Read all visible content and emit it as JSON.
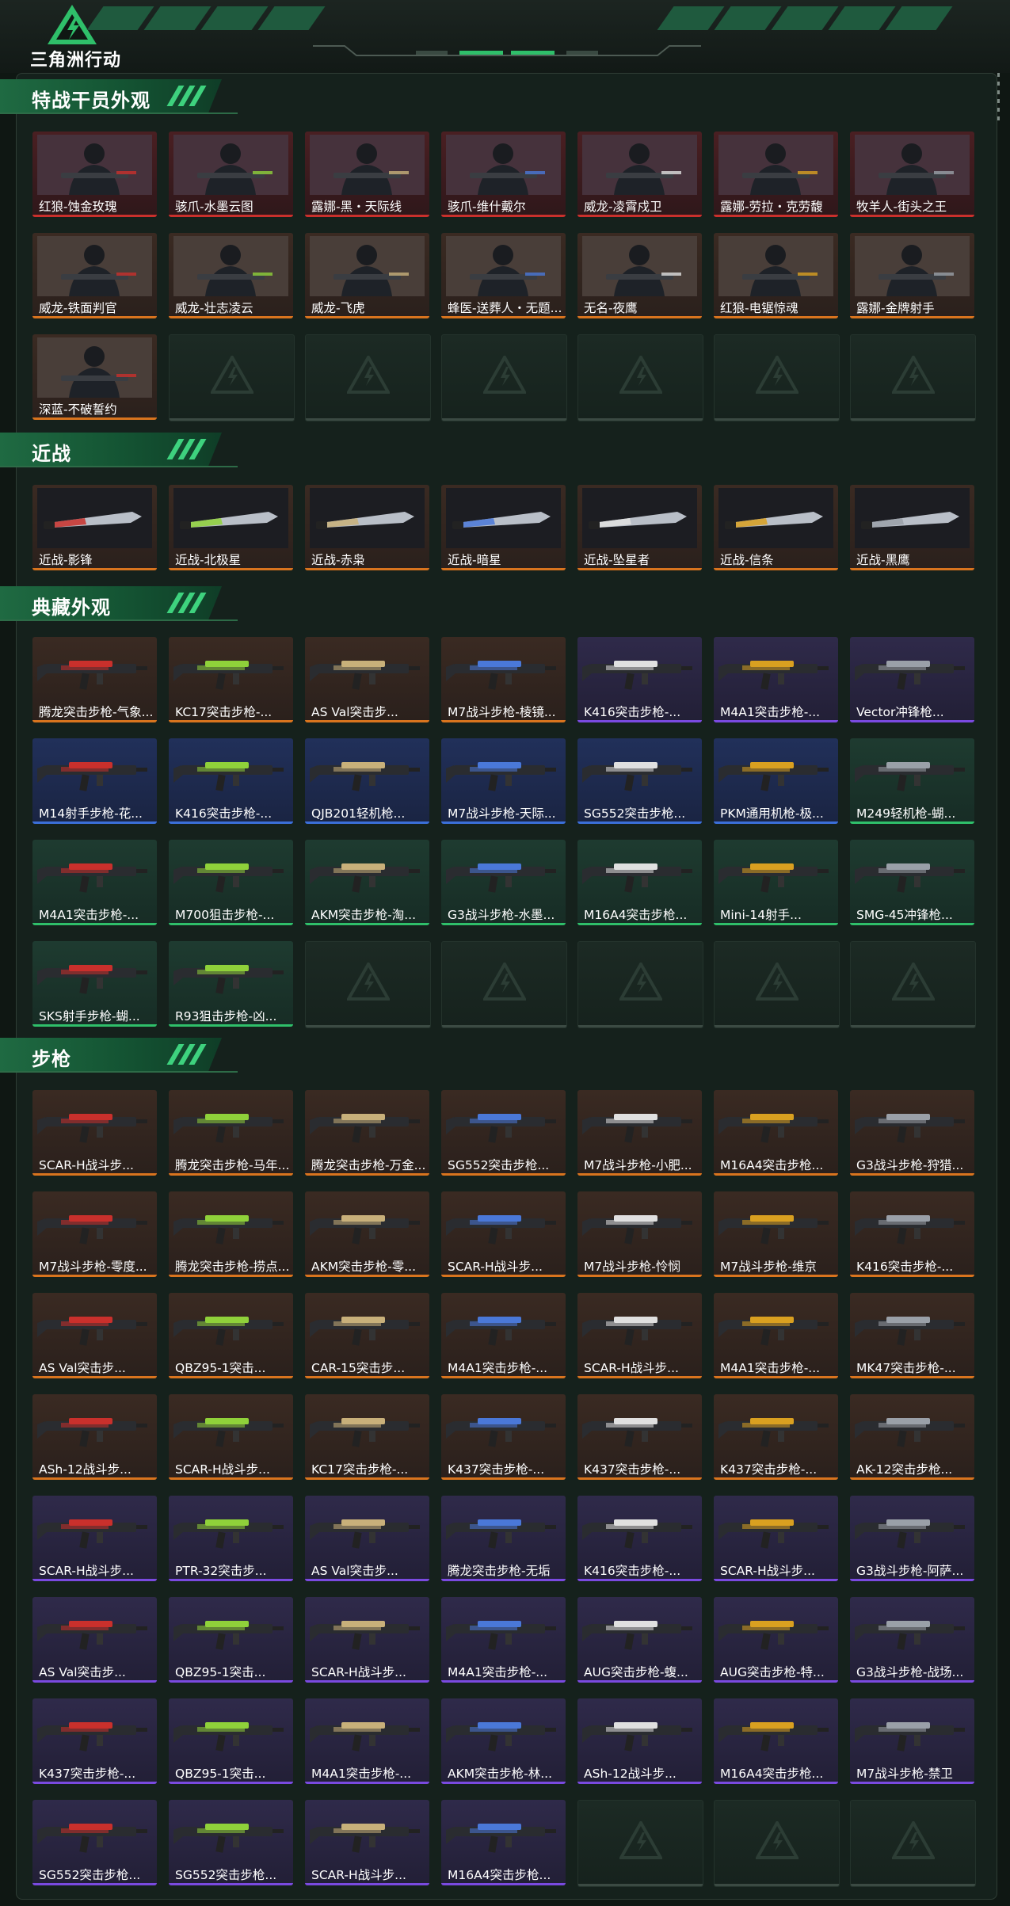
{
  "app": {
    "logo_text": "三角洲行动"
  },
  "sections": [
    {
      "title": "特战干员外观",
      "items": [
        {
          "label": "红狼-蚀金玫瑰",
          "tier": "red",
          "art": "operator"
        },
        {
          "label": "骇爪-水墨云图",
          "tier": "red",
          "art": "operator"
        },
        {
          "label": "露娜-黑・天际线",
          "tier": "red",
          "art": "operator"
        },
        {
          "label": "骇爪-维什戴尔",
          "tier": "red",
          "art": "operator"
        },
        {
          "label": "威龙-凌霄戍卫",
          "tier": "red",
          "art": "operator"
        },
        {
          "label": "露娜-劳拉・克劳馥",
          "tier": "red",
          "art": "operator"
        },
        {
          "label": "牧羊人-街头之王",
          "tier": "red",
          "art": "operator"
        },
        {
          "label": "威龙-铁面判官",
          "tier": "orange",
          "art": "operator"
        },
        {
          "label": "威龙-壮志凌云",
          "tier": "orange",
          "art": "operator"
        },
        {
          "label": "威龙-飞虎",
          "tier": "orange",
          "art": "operator"
        },
        {
          "label": "蜂医-送葬人・无题...",
          "tier": "orange",
          "art": "operator"
        },
        {
          "label": "无名-夜鹰",
          "tier": "orange",
          "art": "operator"
        },
        {
          "label": "红狼-电锯惊魂",
          "tier": "orange",
          "art": "operator"
        },
        {
          "label": "露娜-金牌射手",
          "tier": "orange",
          "art": "operator"
        },
        {
          "label": "深蓝-不破誓约",
          "tier": "orange",
          "art": "operator"
        },
        {
          "empty": true
        },
        {
          "empty": true
        },
        {
          "empty": true
        },
        {
          "empty": true
        },
        {
          "empty": true
        },
        {
          "empty": true
        }
      ]
    },
    {
      "title": "近战",
      "items": [
        {
          "label": "近战-影锋",
          "tier": "orange",
          "art": "melee"
        },
        {
          "label": "近战-北极星",
          "tier": "orange",
          "art": "melee"
        },
        {
          "label": "近战-赤枭",
          "tier": "orange",
          "art": "melee"
        },
        {
          "label": "近战-暗星",
          "tier": "orange",
          "art": "melee"
        },
        {
          "label": "近战-坠星者",
          "tier": "orange",
          "art": "melee"
        },
        {
          "label": "近战-信条",
          "tier": "orange",
          "art": "melee"
        },
        {
          "label": "近战-黑鹰",
          "tier": "orange",
          "art": "melee"
        }
      ]
    },
    {
      "title": "典藏外观",
      "items": [
        {
          "label": "腾龙突击步枪-气象...",
          "tier": "orange",
          "art": "gun"
        },
        {
          "label": "KC17突击步枪-...",
          "tier": "orange",
          "art": "gun"
        },
        {
          "label": "AS Val突击步...",
          "tier": "orange",
          "art": "gun"
        },
        {
          "label": "M7战斗步枪-棱镜...",
          "tier": "orange",
          "art": "gun"
        },
        {
          "label": "K416突击步枪-...",
          "tier": "purple",
          "art": "gun"
        },
        {
          "label": "M4A1突击步枪-...",
          "tier": "purple",
          "art": "gun"
        },
        {
          "label": "Vector冲锋枪...",
          "tier": "purple",
          "art": "gun"
        },
        {
          "label": "M14射手步枪-花...",
          "tier": "blue",
          "art": "gun"
        },
        {
          "label": "K416突击步枪-...",
          "tier": "blue",
          "art": "gun"
        },
        {
          "label": "QJB201轻机枪...",
          "tier": "blue",
          "art": "gun"
        },
        {
          "label": "M7战斗步枪-天际...",
          "tier": "blue",
          "art": "gun"
        },
        {
          "label": "SG552突击步枪...",
          "tier": "blue",
          "art": "gun"
        },
        {
          "label": "PKM通用机枪-极...",
          "tier": "blue",
          "art": "gun"
        },
        {
          "label": "M249轻机枪-蝴...",
          "tier": "green",
          "art": "gun"
        },
        {
          "label": "M4A1突击步枪-...",
          "tier": "green",
          "art": "gun"
        },
        {
          "label": "M700狙击步枪-...",
          "tier": "green",
          "art": "gun"
        },
        {
          "label": "AKM突击步枪-淘...",
          "tier": "green",
          "art": "gun"
        },
        {
          "label": "G3战斗步枪-水墨...",
          "tier": "green",
          "art": "gun"
        },
        {
          "label": "M16A4突击步枪...",
          "tier": "green",
          "art": "gun"
        },
        {
          "label": "Mini-14射手...",
          "tier": "green",
          "art": "gun"
        },
        {
          "label": "SMG-45冲锋枪...",
          "tier": "green",
          "art": "gun"
        },
        {
          "label": "SKS射手步枪-蝴...",
          "tier": "green",
          "art": "gun"
        },
        {
          "label": "R93狙击步枪-凶...",
          "tier": "green",
          "art": "gun"
        },
        {
          "empty": true
        },
        {
          "empty": true
        },
        {
          "empty": true
        },
        {
          "empty": true
        },
        {
          "empty": true
        }
      ]
    },
    {
      "title": "步枪",
      "items": [
        {
          "label": "SCAR-H战斗步...",
          "tier": "orange",
          "art": "gun"
        },
        {
          "label": "腾龙突击步枪-马年...",
          "tier": "orange",
          "art": "gun"
        },
        {
          "label": "腾龙突击步枪-万金...",
          "tier": "orange",
          "art": "gun"
        },
        {
          "label": "SG552突击步枪...",
          "tier": "orange",
          "art": "gun"
        },
        {
          "label": "M7战斗步枪-小肥...",
          "tier": "orange",
          "art": "gun"
        },
        {
          "label": "M16A4突击步枪...",
          "tier": "orange",
          "art": "gun"
        },
        {
          "label": "G3战斗步枪-狩猎...",
          "tier": "orange",
          "art": "gun"
        },
        {
          "label": "M7战斗步枪-零度...",
          "tier": "orange",
          "art": "gun"
        },
        {
          "label": "腾龙突击步枪-捞点...",
          "tier": "orange",
          "art": "gun"
        },
        {
          "label": "AKM突击步枪-零...",
          "tier": "orange",
          "art": "gun"
        },
        {
          "label": "SCAR-H战斗步...",
          "tier": "orange",
          "art": "gun"
        },
        {
          "label": "M7战斗步枪-怜悯",
          "tier": "orange",
          "art": "gun"
        },
        {
          "label": "M7战斗步枪-维京",
          "tier": "orange",
          "art": "gun"
        },
        {
          "label": "K416突击步枪-...",
          "tier": "orange",
          "art": "gun"
        },
        {
          "label": "AS Val突击步...",
          "tier": "orange",
          "art": "gun"
        },
        {
          "label": "QBZ95-1突击...",
          "tier": "orange",
          "art": "gun"
        },
        {
          "label": "CAR-15突击步...",
          "tier": "orange",
          "art": "gun"
        },
        {
          "label": "M4A1突击步枪-...",
          "tier": "orange",
          "art": "gun"
        },
        {
          "label": "SCAR-H战斗步...",
          "tier": "orange",
          "art": "gun"
        },
        {
          "label": "M4A1突击步枪-...",
          "tier": "orange",
          "art": "gun"
        },
        {
          "label": "MK47突击步枪-...",
          "tier": "orange",
          "art": "gun"
        },
        {
          "label": "ASh-12战斗步...",
          "tier": "orange",
          "art": "gun"
        },
        {
          "label": "SCAR-H战斗步...",
          "tier": "orange",
          "art": "gun"
        },
        {
          "label": "KC17突击步枪-...",
          "tier": "orange",
          "art": "gun"
        },
        {
          "label": "K437突击步枪-...",
          "tier": "orange",
          "art": "gun"
        },
        {
          "label": "K437突击步枪-...",
          "tier": "orange",
          "art": "gun"
        },
        {
          "label": "K437突击步枪-...",
          "tier": "orange",
          "art": "gun"
        },
        {
          "label": "AK-12突击步枪...",
          "tier": "orange",
          "art": "gun"
        },
        {
          "label": "SCAR-H战斗步...",
          "tier": "purple",
          "art": "gun"
        },
        {
          "label": "PTR-32突击步...",
          "tier": "purple",
          "art": "gun"
        },
        {
          "label": "AS Val突击步...",
          "tier": "purple",
          "art": "gun"
        },
        {
          "label": "腾龙突击步枪-无垢",
          "tier": "purple",
          "art": "gun"
        },
        {
          "label": "K416突击步枪-...",
          "tier": "purple",
          "art": "gun"
        },
        {
          "label": "SCAR-H战斗步...",
          "tier": "purple",
          "art": "gun"
        },
        {
          "label": "G3战斗步枪-阿萨...",
          "tier": "purple",
          "art": "gun"
        },
        {
          "label": "AS Val突击步...",
          "tier": "purple",
          "art": "gun"
        },
        {
          "label": "QBZ95-1突击...",
          "tier": "purple",
          "art": "gun"
        },
        {
          "label": "SCAR-H战斗步...",
          "tier": "purple",
          "art": "gun"
        },
        {
          "label": "M4A1突击步枪-...",
          "tier": "purple",
          "art": "gun"
        },
        {
          "label": "AUG突击步枪-蝮...",
          "tier": "purple",
          "art": "gun"
        },
        {
          "label": "AUG突击步枪-特...",
          "tier": "purple",
          "art": "gun"
        },
        {
          "label": "G3战斗步枪-战场...",
          "tier": "purple",
          "art": "gun"
        },
        {
          "label": "K437突击步枪-...",
          "tier": "purple",
          "art": "gun"
        },
        {
          "label": "QBZ95-1突击...",
          "tier": "purple",
          "art": "gun"
        },
        {
          "label": "M4A1突击步枪-...",
          "tier": "purple",
          "art": "gun"
        },
        {
          "label": "AKM突击步枪-林...",
          "tier": "purple",
          "art": "gun"
        },
        {
          "label": "ASh-12战斗步...",
          "tier": "purple",
          "art": "gun"
        },
        {
          "label": "M16A4突击步枪...",
          "tier": "purple",
          "art": "gun"
        },
        {
          "label": "M7战斗步枪-禁卫",
          "tier": "purple",
          "art": "gun"
        },
        {
          "label": "SG552突击步枪...",
          "tier": "purple",
          "art": "gun"
        },
        {
          "label": "SG552突击步枪...",
          "tier": "purple",
          "art": "gun"
        },
        {
          "label": "SCAR-H战斗步...",
          "tier": "purple",
          "art": "gun"
        },
        {
          "label": "M16A4突击步枪...",
          "tier": "purple",
          "art": "gun"
        },
        {
          "empty": true
        },
        {
          "empty": true
        },
        {
          "empty": true
        }
      ]
    }
  ],
  "colors": {
    "accent_green": "#2fbf6a",
    "tier_orange": "#d9741e",
    "tier_red": "#c9302c",
    "tier_purple": "#7a4ae0",
    "tier_blue": "#3b6fd9",
    "tier_green": "#2fbf6a"
  }
}
